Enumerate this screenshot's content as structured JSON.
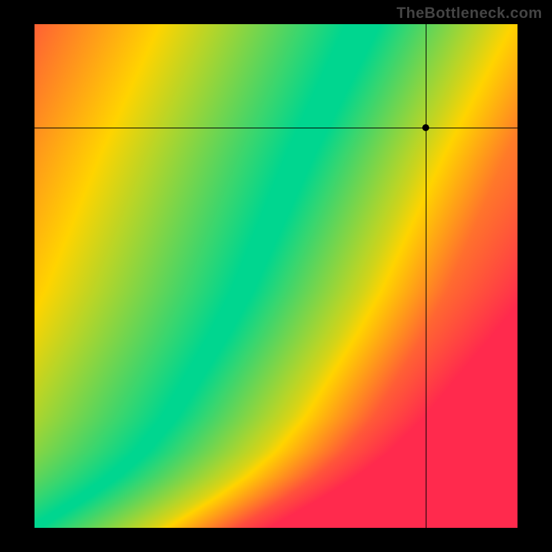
{
  "watermark": "TheBottleneck.com",
  "chart_data": {
    "type": "heatmap",
    "title": "",
    "xlabel": "",
    "ylabel": "",
    "xlim": [
      0,
      1
    ],
    "ylim": [
      0,
      1
    ],
    "description": "Red-yellow-green bottleneck heatmap. Green ridge marks balanced pairings; red regions mark heavy bottleneck.",
    "color_scale": [
      {
        "value": 0.0,
        "color": "#ff2a4d"
      },
      {
        "value": 0.5,
        "color": "#ffd400"
      },
      {
        "value": 1.0,
        "color": "#00d68f"
      }
    ],
    "ideal_curve": [
      {
        "x": 0.0,
        "y": 0.0
      },
      {
        "x": 0.05,
        "y": 0.03
      },
      {
        "x": 0.1,
        "y": 0.06
      },
      {
        "x": 0.16,
        "y": 0.1
      },
      {
        "x": 0.22,
        "y": 0.15
      },
      {
        "x": 0.28,
        "y": 0.22
      },
      {
        "x": 0.33,
        "y": 0.3
      },
      {
        "x": 0.38,
        "y": 0.38
      },
      {
        "x": 0.43,
        "y": 0.47
      },
      {
        "x": 0.47,
        "y": 0.56
      },
      {
        "x": 0.51,
        "y": 0.65
      },
      {
        "x": 0.55,
        "y": 0.74
      },
      {
        "x": 0.59,
        "y": 0.82
      },
      {
        "x": 0.63,
        "y": 0.9
      },
      {
        "x": 0.68,
        "y": 1.0
      }
    ],
    "ridge_width_base": 0.03,
    "ridge_width_top": 0.09,
    "crosshair": {
      "x": 0.81,
      "y": 0.795
    },
    "marker": {
      "x": 0.81,
      "y": 0.795
    }
  }
}
